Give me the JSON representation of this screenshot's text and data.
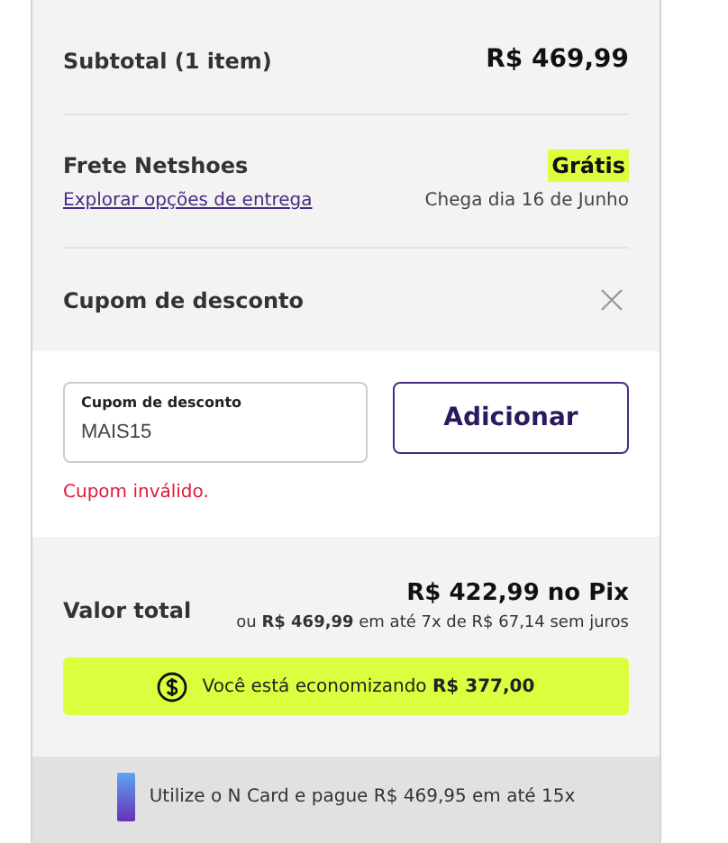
{
  "subtotal": {
    "label": "Subtotal (1 item)",
    "value": "R$ 469,99"
  },
  "shipping": {
    "label": "Frete Netshoes",
    "price": "Grátis",
    "link": "Explorar opções de entrega",
    "arrival": "Chega dia 16 de Junho"
  },
  "coupon": {
    "title": "Cupom de desconto",
    "field_label": "Cupom de desconto",
    "value": "MAIS15",
    "button": "Adicionar",
    "error": "Cupom inválido."
  },
  "total": {
    "label": "Valor total",
    "pix_price": "R$ 422,99 no Pix",
    "installments": "ou **R$ 469,99** em até 7x de R$ 67,14 sem juros"
  },
  "savings": "Você está economizando **R$ 377,00**",
  "card_promo": "Utilize o N Card e pague R$ 469,95 em até 15x"
}
